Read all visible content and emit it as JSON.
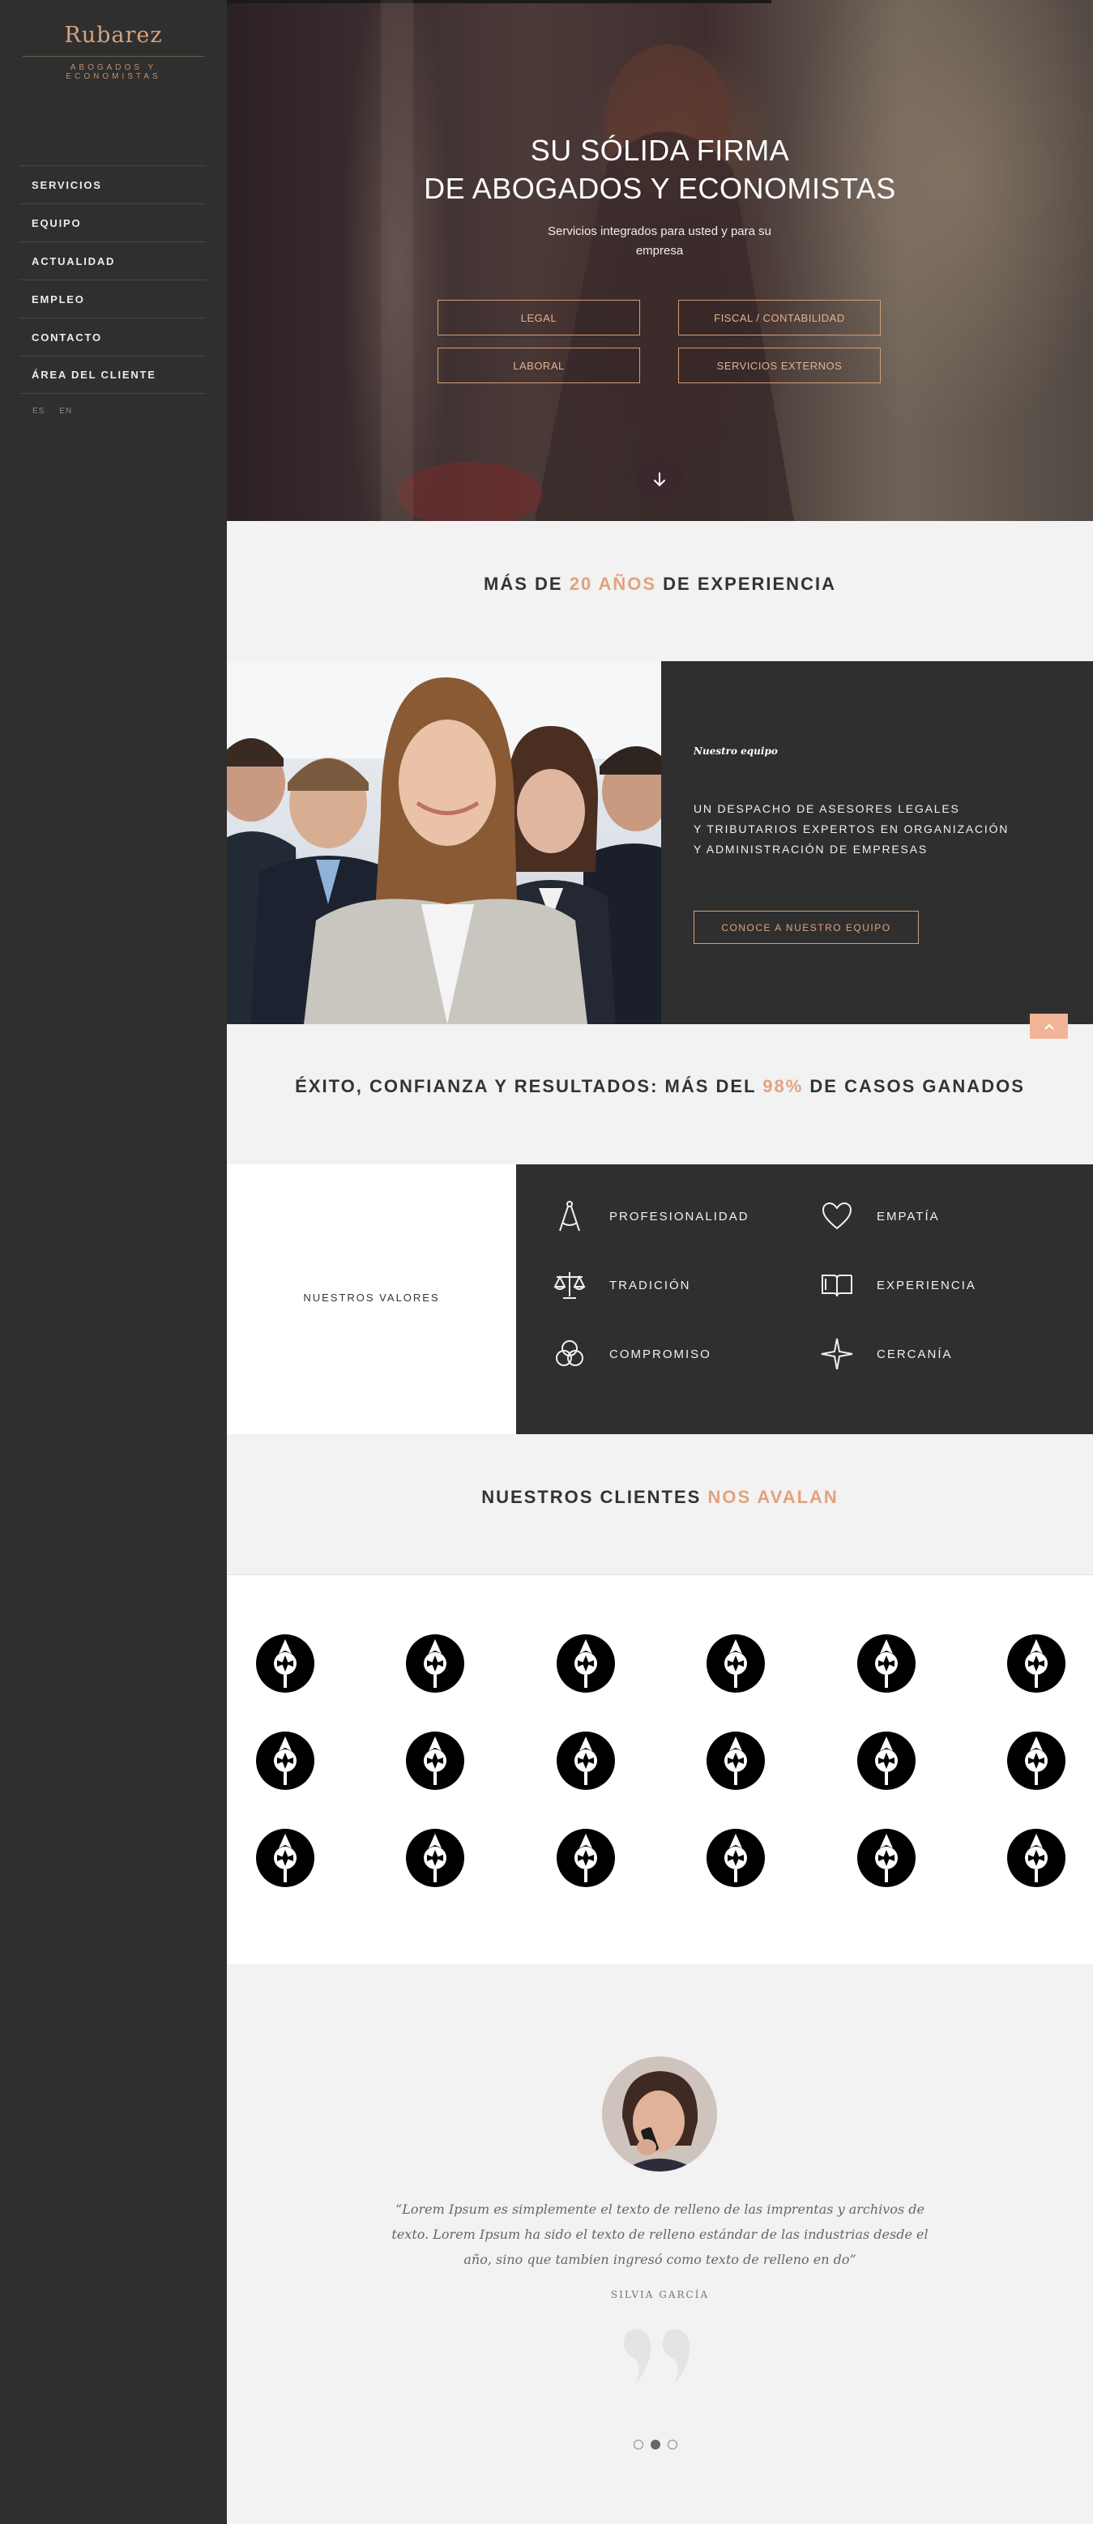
{
  "brand": {
    "name": "Rubarez",
    "tagline": "Abogados y Economistas",
    "accent_color": "#e3a27d",
    "dark_color": "#2f2f2f"
  },
  "nav": {
    "items": [
      "SERVICIOS",
      "EQUIPO",
      "ACTUALIDAD",
      "EMPLEO",
      "CONTACTO",
      "ÁREA DEL CLIENTE"
    ],
    "languages": [
      "ES",
      "EN"
    ]
  },
  "hero": {
    "title_line1": "SU SÓLIDA FIRMA",
    "title_line2": "DE ABOGADOS Y ECONOMISTAS",
    "subtitle": "Servicios integrados para usted y para su empresa",
    "buttons": [
      "LEGAL",
      "FISCAL / CONTABILIDAD",
      "LABORAL",
      "SERVICIOS EXTERNOS"
    ],
    "scroll_icon": "arrow-down-icon"
  },
  "experience": {
    "prefix": "MÁS DE ",
    "highlight": "20 AÑOS",
    "suffix": " DE EXPERIENCIA"
  },
  "team": {
    "label": "Nuestro equipo",
    "desc_lines": [
      "UN DESPACHO DE ASESORES LEGALES",
      "Y TRIBUTARIOS EXPERTOS EN ORGANIZACIÓN",
      "Y ADMINISTRACIÓN DE EMPRESAS"
    ],
    "button": "CONOCE A NUESTRO EQUIPO"
  },
  "success": {
    "prefix": "ÉXITO, CONFIANZA Y RESULTADOS: MÁS DEL ",
    "highlight": "98%",
    "suffix": " DE CASOS GANADOS"
  },
  "values": {
    "label": "NUESTROS VALORES",
    "items": [
      {
        "label": "PROFESIONALIDAD",
        "icon": "compass-icon"
      },
      {
        "label": "EMPATÍA",
        "icon": "heart-icon"
      },
      {
        "label": "TRADICIÓN",
        "icon": "scales-icon"
      },
      {
        "label": "EXPERIENCIA",
        "icon": "book-icon"
      },
      {
        "label": "COMPROMISO",
        "icon": "knot-icon"
      },
      {
        "label": "CERCANÍA",
        "icon": "star-icon"
      }
    ]
  },
  "clients": {
    "prefix": "NUESTROS CLIENTES ",
    "highlight": "NOS AVALAN",
    "logo_icon": "client-logo-icon",
    "logo_count": 18
  },
  "testimonial": {
    "quote": "“Lorem Ipsum es simplemente el texto de relleno de las imprentas y archivos de texto. Lorem Ipsum ha sido el texto de relleno estándar de las industrias desde el año, sino que tambien ingresó como texto de relleno en do”",
    "author": "SILVIA GARCÍA",
    "slides": 3,
    "active_slide": 2
  }
}
